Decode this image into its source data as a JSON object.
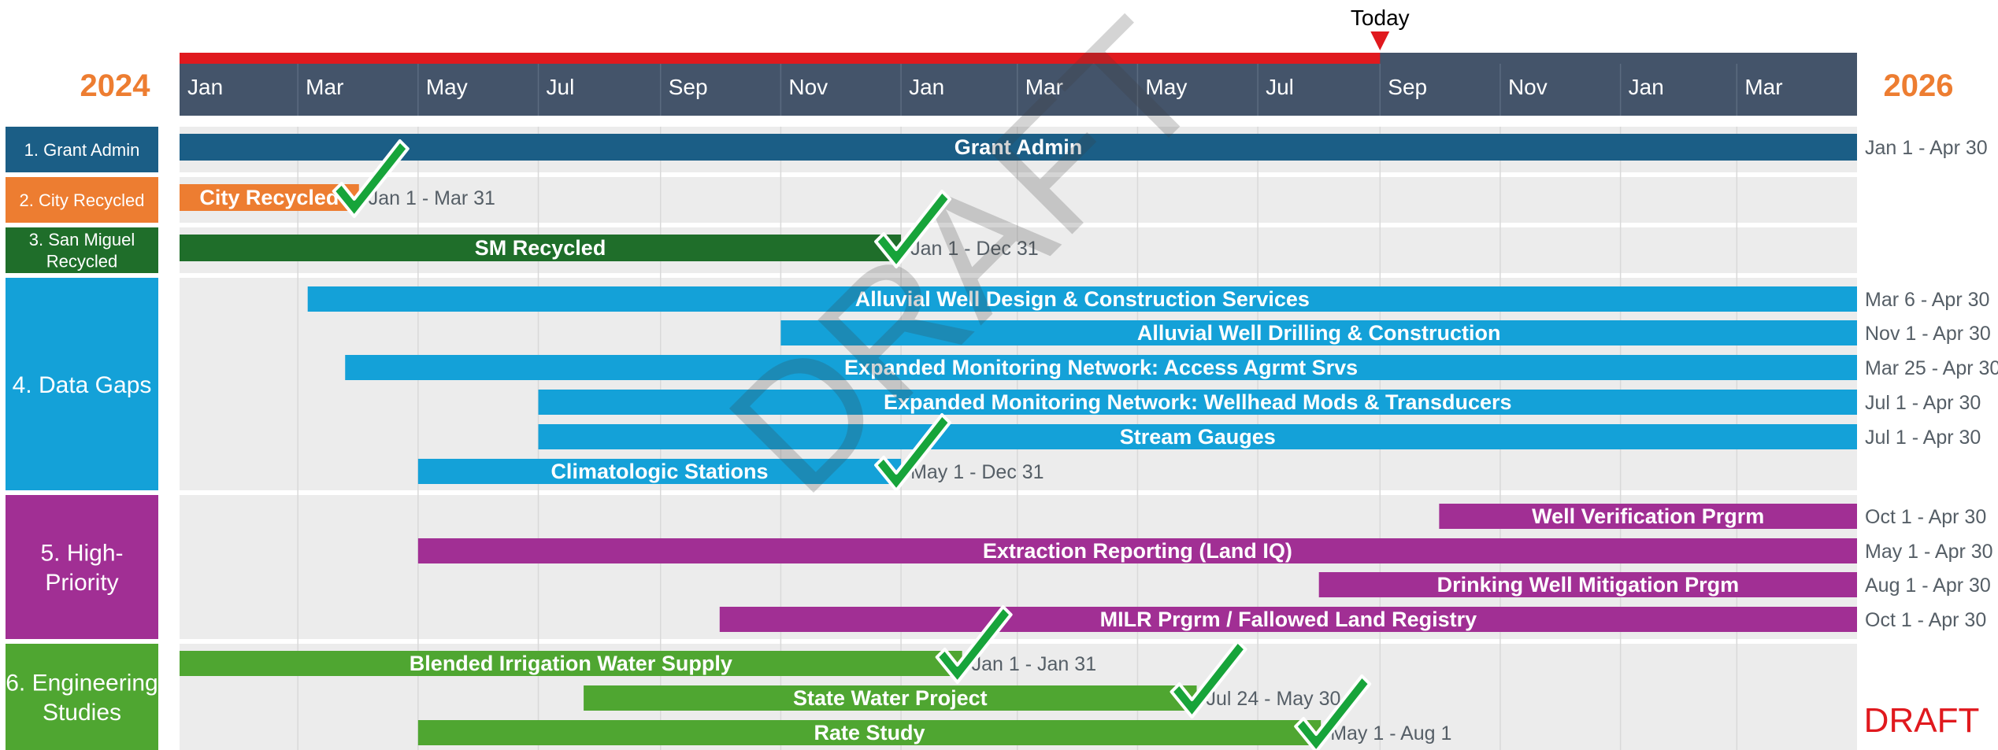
{
  "chart_data": {
    "type": "gantt",
    "start_year": "2024",
    "end_year": "2026",
    "months": [
      "Jan",
      "Mar",
      "May",
      "Jul",
      "Sep",
      "Nov",
      "Jan",
      "Mar",
      "May",
      "Jul",
      "Sep",
      "Nov",
      "Jan",
      "Mar"
    ],
    "today_label": "Today",
    "today_date": "2025-09-01",
    "watermark": "DRAFT",
    "draft_label": "DRAFT",
    "colors": {
      "grant": "#1b5e86",
      "city": "#ed7d31",
      "sm": "#1f6e2a",
      "data_gaps": "#14a1d8",
      "high_priority": "#a12f94",
      "engineering": "#4fa631",
      "header": "#44546a",
      "today_bar": "#e0191e",
      "year_text": "#ed7d31",
      "checkmark": "#17a43a",
      "row_band": "#ececec"
    },
    "groups": [
      {
        "label": "1. Grant Admin",
        "color": "#1b5e86",
        "tasks": [
          {
            "name": "Grant Admin",
            "start": "2024-01-01",
            "end": "2026-04-30",
            "range": "Jan 1 - Apr 30",
            "done": false
          }
        ]
      },
      {
        "label": "2. City Recycled",
        "color": "#ed7d31",
        "tasks": [
          {
            "name": "City Recycled",
            "start": "2024-01-01",
            "end": "2024-03-31",
            "range": "Jan 1 - Mar 31",
            "done": true
          }
        ]
      },
      {
        "label": "3. San Miguel Recycled",
        "color": "#1f6e2a",
        "tasks": [
          {
            "name": "SM Recycled",
            "start": "2024-01-01",
            "end": "2024-12-31",
            "range": "Jan 1 - Dec 31",
            "done": true
          }
        ]
      },
      {
        "label": "4. Data Gaps",
        "color": "#14a1d8",
        "tasks": [
          {
            "name": "Alluvial Well Design & Construction Services",
            "start": "2024-03-06",
            "end": "2026-04-30",
            "range": "Mar 6 - Apr 30",
            "done": false
          },
          {
            "name": "Alluvial Well Drilling & Construction",
            "start": "2024-11-01",
            "end": "2026-04-30",
            "range": "Nov 1 - Apr 30",
            "done": false
          },
          {
            "name": "Expanded Monitoring Network: Access Agrmt Srvs",
            "start": "2024-03-25",
            "end": "2026-04-30",
            "range": "Mar 25 - Apr 30",
            "done": false
          },
          {
            "name": "Expanded Monitoring Network: Wellhead Mods & Transducers",
            "start": "2024-07-01",
            "end": "2026-04-30",
            "range": "Jul 1 - Apr 30",
            "done": false
          },
          {
            "name": "Stream Gauges",
            "start": "2024-07-01",
            "end": "2026-04-30",
            "range": "Jul 1 - Apr 30",
            "done": false
          },
          {
            "name": "Climatologic Stations",
            "start": "2024-05-01",
            "end": "2024-12-31",
            "range": "May 1 - Dec 31",
            "done": true
          }
        ]
      },
      {
        "label": "5. High-Priority",
        "color": "#a12f94",
        "tasks": [
          {
            "name": "Well Verification Prgrm",
            "start": "2025-10-01",
            "end": "2026-04-30",
            "range": "Oct 1 - Apr 30",
            "done": false
          },
          {
            "name": "Extraction Reporting (Land IQ)",
            "start": "2024-05-01",
            "end": "2026-04-30",
            "range": "May 1 - Apr 30",
            "done": false
          },
          {
            "name": "Drinking Well Mitigation Prgm",
            "start": "2025-08-01",
            "end": "2026-04-30",
            "range": "Aug 1 - Apr 30",
            "done": false
          },
          {
            "name": "MILR Prgrm / Fallowed Land Registry",
            "start": "2024-10-01",
            "end": "2026-04-30",
            "range": "Oct 1 - Apr 30",
            "done": false
          }
        ]
      },
      {
        "label": "6. Engineering Studies",
        "color": "#4fa631",
        "tasks": [
          {
            "name": "Blended Irrigation Water Supply",
            "start": "2024-01-01",
            "end": "2025-01-31",
            "range": "Jan 1 - Jan 31",
            "done": true
          },
          {
            "name": "State Water Project",
            "start": "2024-07-24",
            "end": "2025-05-30",
            "range": "Jul 24 - May 30",
            "done": true
          },
          {
            "name": "Rate Study",
            "start": "2024-05-01",
            "end": "2025-08-01",
            "range": "May 1 - Aug 1",
            "done": true
          }
        ]
      }
    ]
  }
}
